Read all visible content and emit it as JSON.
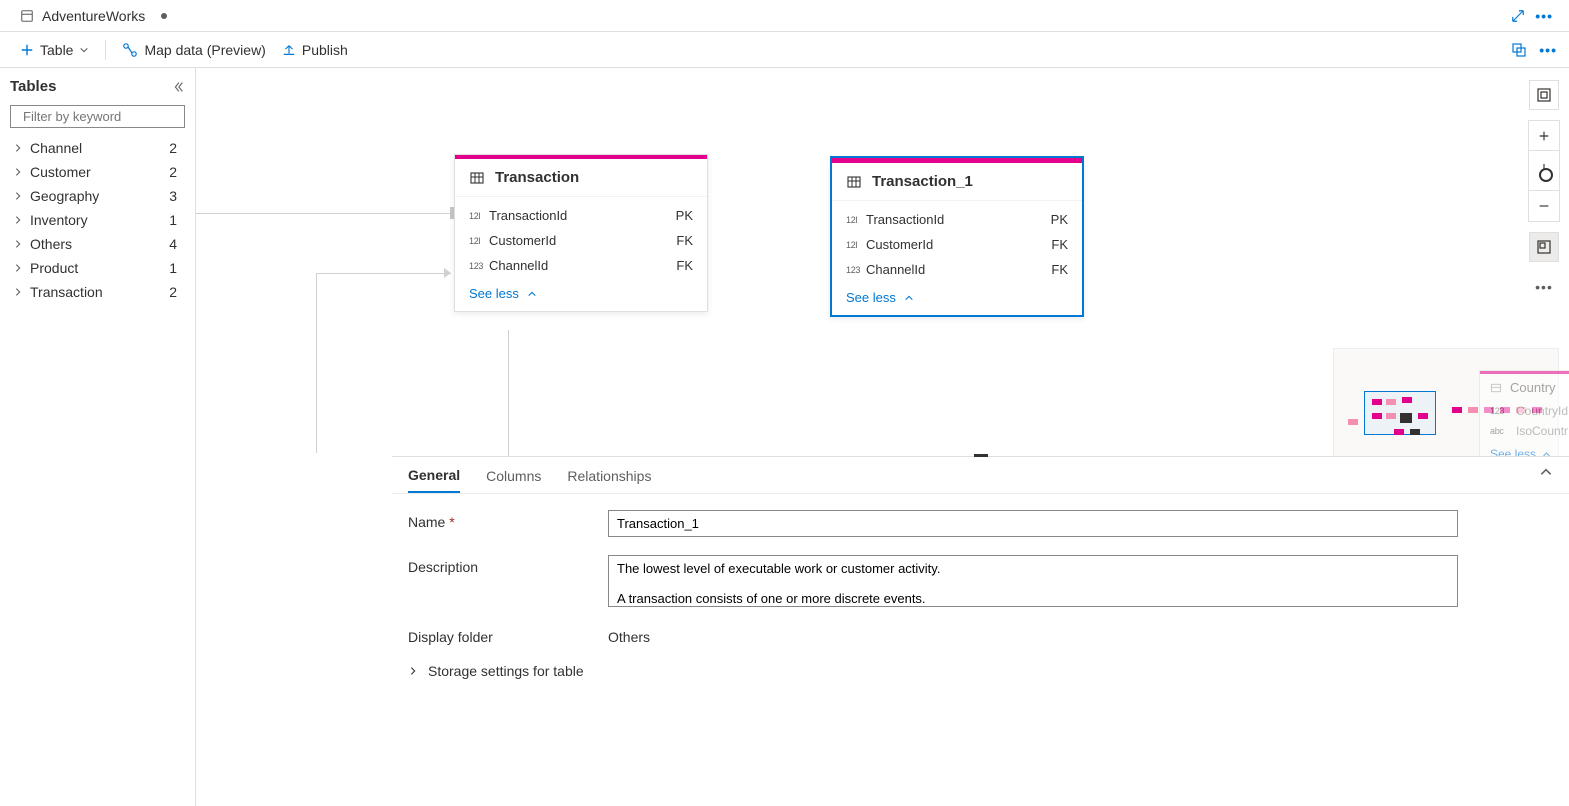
{
  "tab": {
    "name": "AdventureWorks"
  },
  "toolbar": {
    "table": "Table",
    "mapdata": "Map data (Preview)",
    "publish": "Publish"
  },
  "sidebar": {
    "title": "Tables",
    "filter_placeholder": "Filter by keyword",
    "items": [
      {
        "label": "Channel",
        "count": "2"
      },
      {
        "label": "Customer",
        "count": "2"
      },
      {
        "label": "Geography",
        "count": "3"
      },
      {
        "label": "Inventory",
        "count": "1"
      },
      {
        "label": "Others",
        "count": "4"
      },
      {
        "label": "Product",
        "count": "1"
      },
      {
        "label": "Transaction",
        "count": "2"
      }
    ]
  },
  "cards": {
    "transaction": {
      "title": "Transaction",
      "cols": [
        {
          "type": "12l",
          "name": "TransactionId",
          "key": "PK"
        },
        {
          "type": "12l",
          "name": "CustomerId",
          "key": "FK"
        },
        {
          "type": "123",
          "name": "ChannelId",
          "key": "FK"
        }
      ],
      "seeless": "See less"
    },
    "transaction1": {
      "title": "Transaction_1",
      "cols": [
        {
          "type": "12l",
          "name": "TransactionId",
          "key": "PK"
        },
        {
          "type": "12l",
          "name": "CustomerId",
          "key": "FK"
        },
        {
          "type": "123",
          "name": "ChannelId",
          "key": "FK"
        }
      ],
      "seeless": "See less"
    }
  },
  "ghost": {
    "title": "Country",
    "row1_type": "123",
    "row1_name": "CountryId",
    "row2_type": "abc",
    "row2_name": "IsoCountr",
    "seeless": "See less"
  },
  "details": {
    "tabs": {
      "general": "General",
      "columns": "Columns",
      "relationships": "Relationships"
    },
    "name_label": "Name",
    "name_value": "Transaction_1",
    "desc_label": "Description",
    "desc_value": "The lowest level of executable work or customer activity.\n\nA transaction consists of one or more discrete events.",
    "folder_label": "Display folder",
    "folder_value": "Others",
    "storage": "Storage settings for table"
  }
}
